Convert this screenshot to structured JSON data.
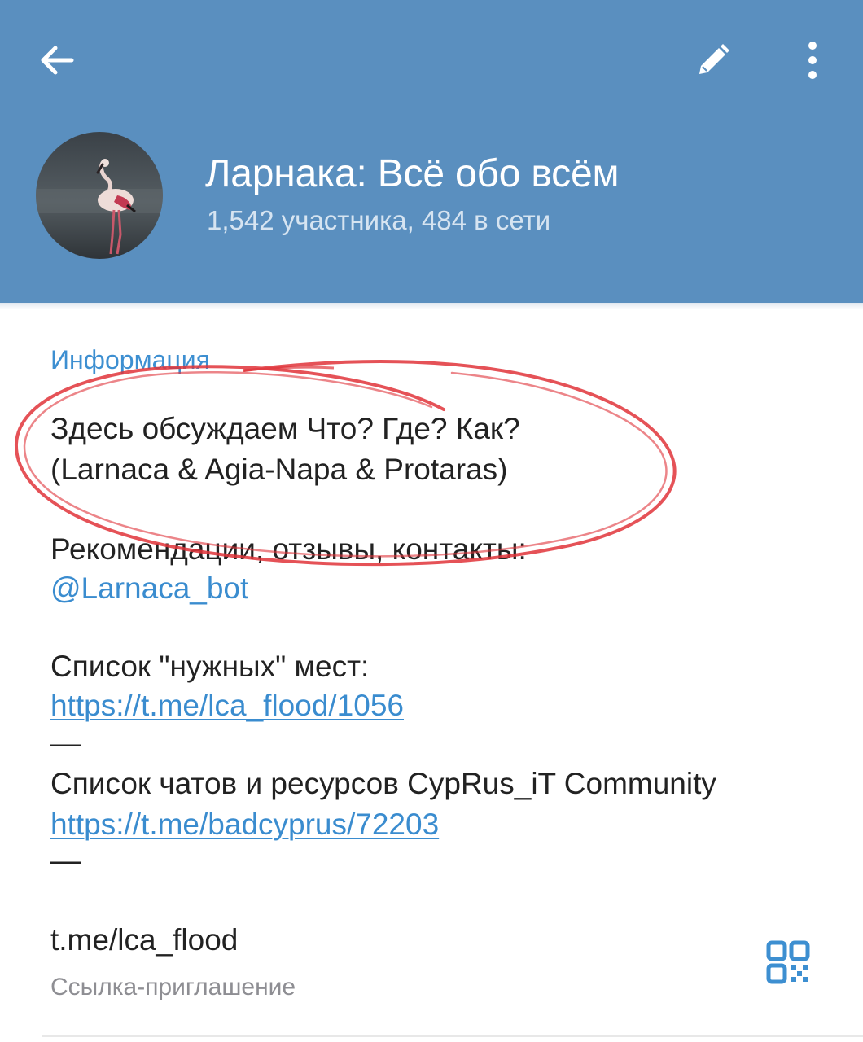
{
  "header": {
    "back_icon": "arrow-left-icon",
    "edit_icon": "pencil-icon",
    "more_icon": "more-vertical-icon",
    "background_color": "#5a8fbf"
  },
  "group": {
    "title": "Ларнака: Всё обо всём",
    "subtitle": "1,542 участника, 484 в сети",
    "avatar": "flamingo-photo"
  },
  "info": {
    "section_title": "Информация",
    "lines": [
      "Здесь обсуждаем Что? Где? Как?",
      "(Larnaca & Agia-Napa & Protaras)",
      "Рекомендации, отзывы, контакты:",
      "@Larnaca_bot",
      "Список \"нужных\" мест:",
      "https://t.me/lca_flood/1056",
      "—",
      "Список чатов и ресурсов CypRus_iT Community",
      "https://t.me/badcyprus/72203",
      "—"
    ]
  },
  "invite": {
    "link": "t.me/lca_flood",
    "label": "Ссылка-приглашение",
    "qr_icon": "qr-code-icon"
  },
  "annotation": {
    "type": "hand-drawn-circle",
    "color": "#e0343a"
  },
  "colors": {
    "accent": "#3d8fd1",
    "link": "#3a8ccf",
    "text": "#222222",
    "secondary": "#8e8e93"
  }
}
